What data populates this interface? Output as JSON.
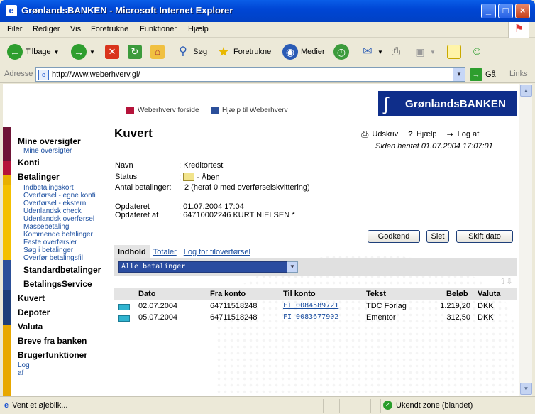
{
  "window": {
    "title": "GrønlandsBANKEN - Microsoft Internet Explorer"
  },
  "menu": [
    "Filer",
    "Rediger",
    "Vis",
    "Foretrukne",
    "Funktioner",
    "Hjælp"
  ],
  "toolbar": {
    "back": "Tilbage",
    "search": "Søg",
    "favorites": "Foretrukne",
    "media": "Medier"
  },
  "address": {
    "label": "Adresse",
    "url": "http://www.weberhverv.gl/",
    "go": "Gå",
    "links": "Links"
  },
  "status": {
    "text": "Vent et øjeblik...",
    "zone": "Ukendt zone (blandet)"
  },
  "header": {
    "logo": "GrønlandsBANKEN",
    "link1": "Weberhverv forside",
    "link2": "Hjælp til Weberhverv",
    "link1_color": "#b5133a",
    "link2_color": "#2b4f9a"
  },
  "nav": {
    "mine_oversigter": "Mine oversigter",
    "mine_oversigter_sub": "Mine oversigter",
    "konti": "Konti",
    "betalinger": "Betalinger",
    "betalinger_sub": [
      "Indbetalingskort",
      "Overførsel - egne konti",
      "Overførsel - ekstern",
      "Udenlandsk check",
      "Udenlandsk overførsel",
      "Massebetaling",
      "Kommende betalinger",
      "Faste overførsler",
      "Søg i betalinger",
      "Overfør betalingsfil"
    ],
    "standardbetalinger": "Standardbetalinger",
    "betalingsservice": "BetalingsService",
    "kuvert": "Kuvert",
    "depoter": "Depoter",
    "valuta": "Valuta",
    "breve": "Breve fra banken",
    "brugerfunktioner": "Brugerfunktioner",
    "log_af": "Log af"
  },
  "page": {
    "title": "Kuvert",
    "print": "Udskriv",
    "help_mark": "?",
    "help": "Hjælp",
    "logout": "Log af",
    "fetched": "Siden hentet 01.07.2004 17:07:01"
  },
  "info": {
    "navn_label": "Navn",
    "navn_value": ": Kreditortest",
    "status_label": "Status",
    "status_value": "-  Åben",
    "status_colon": ":",
    "antal_label": "Antal betalinger:",
    "antal_value": "2 (heraf 0 med overførselskvittering)",
    "opdateret_label": "Opdateret",
    "opdateret_value": ": 01.07.2004 17:04",
    "opdateret_af_label": "Opdateret af",
    "opdateret_af_value": ": 64710002246 KURT NIELSEN *"
  },
  "buttons": {
    "godkend": "Godkend",
    "slet": "Slet",
    "skift_dato": "Skift dato"
  },
  "tabs": [
    "Indhold",
    "Totaler",
    "Log for filoverførsel"
  ],
  "filter": {
    "selected": "Alle betalinger"
  },
  "table": {
    "headers": [
      "Dato",
      "Fra konto",
      "Til konto",
      "Tekst",
      "Beløb",
      "Valuta"
    ],
    "rows": [
      {
        "dato": "02.07.2004",
        "fra": "64711518248",
        "til": "FI 0084589721",
        "tekst": "TDC Forlag",
        "belob": "1.219,20",
        "valuta": "DKK"
      },
      {
        "dato": "05.07.2004",
        "fra": "64711518248",
        "til": "FI 0083677902",
        "tekst": "Ementor",
        "belob": "312,50",
        "valuta": "DKK"
      }
    ]
  }
}
